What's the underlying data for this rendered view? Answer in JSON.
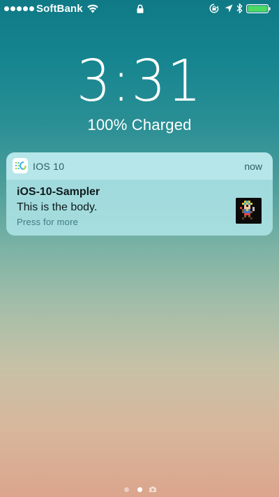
{
  "status_bar": {
    "carrier": "SoftBank",
    "signal_bars": 5,
    "icons": [
      "signal-dots",
      "wifi-icon",
      "lock-icon",
      "rotation-lock-icon",
      "location-arrow-icon",
      "bluetooth-icon",
      "battery-icon"
    ],
    "battery_level": 1.0,
    "battery_color": "#4cd964"
  },
  "lock_screen": {
    "time": "3:31",
    "charge_status": "100% Charged"
  },
  "notification": {
    "app_name": "IOS 10",
    "time": "now",
    "title": "iOS-10-Sampler",
    "body": "This is the body.",
    "hint": "Press for more",
    "icon": "app-icon",
    "thumbnail": "pixel-art-character-thumbnail"
  },
  "page_indicator": {
    "pages": 3,
    "current_page": 2,
    "last_icon": "camera-icon"
  }
}
